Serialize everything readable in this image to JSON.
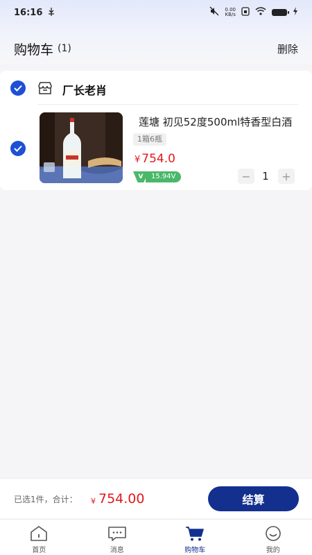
{
  "status_bar": {
    "time": "16:16",
    "usb_icon": "usb-icon",
    "net_speed_value": "0.00",
    "net_speed_unit": "KB/s"
  },
  "header": {
    "title": "购物车",
    "count": "(1)",
    "delete_label": "删除"
  },
  "store": {
    "name": "厂长老肖"
  },
  "product": {
    "title": "莲塘 初见52度500ml特香型白酒",
    "spec": "1箱6瓶",
    "price_symbol": "¥",
    "price": "754.0",
    "v_mark": "V",
    "v_value": "15.94V",
    "quantity": "1",
    "minus_label": "−",
    "plus_label": "+"
  },
  "checkout": {
    "selected_text": "已选1件，合计：",
    "total_symbol": "¥",
    "total": "754.00",
    "button_label": "结算"
  },
  "tabs": [
    {
      "label": "首页",
      "icon": "home-icon",
      "active": false
    },
    {
      "label": "消息",
      "icon": "message-icon",
      "active": false
    },
    {
      "label": "购物车",
      "icon": "cart-icon",
      "active": true
    },
    {
      "label": "我的",
      "icon": "profile-icon",
      "active": false
    }
  ],
  "colors": {
    "primary": "#14308e",
    "check_blue": "#1f4fd6",
    "price_red": "#e0191f",
    "badge_green": "#4ab86a"
  }
}
